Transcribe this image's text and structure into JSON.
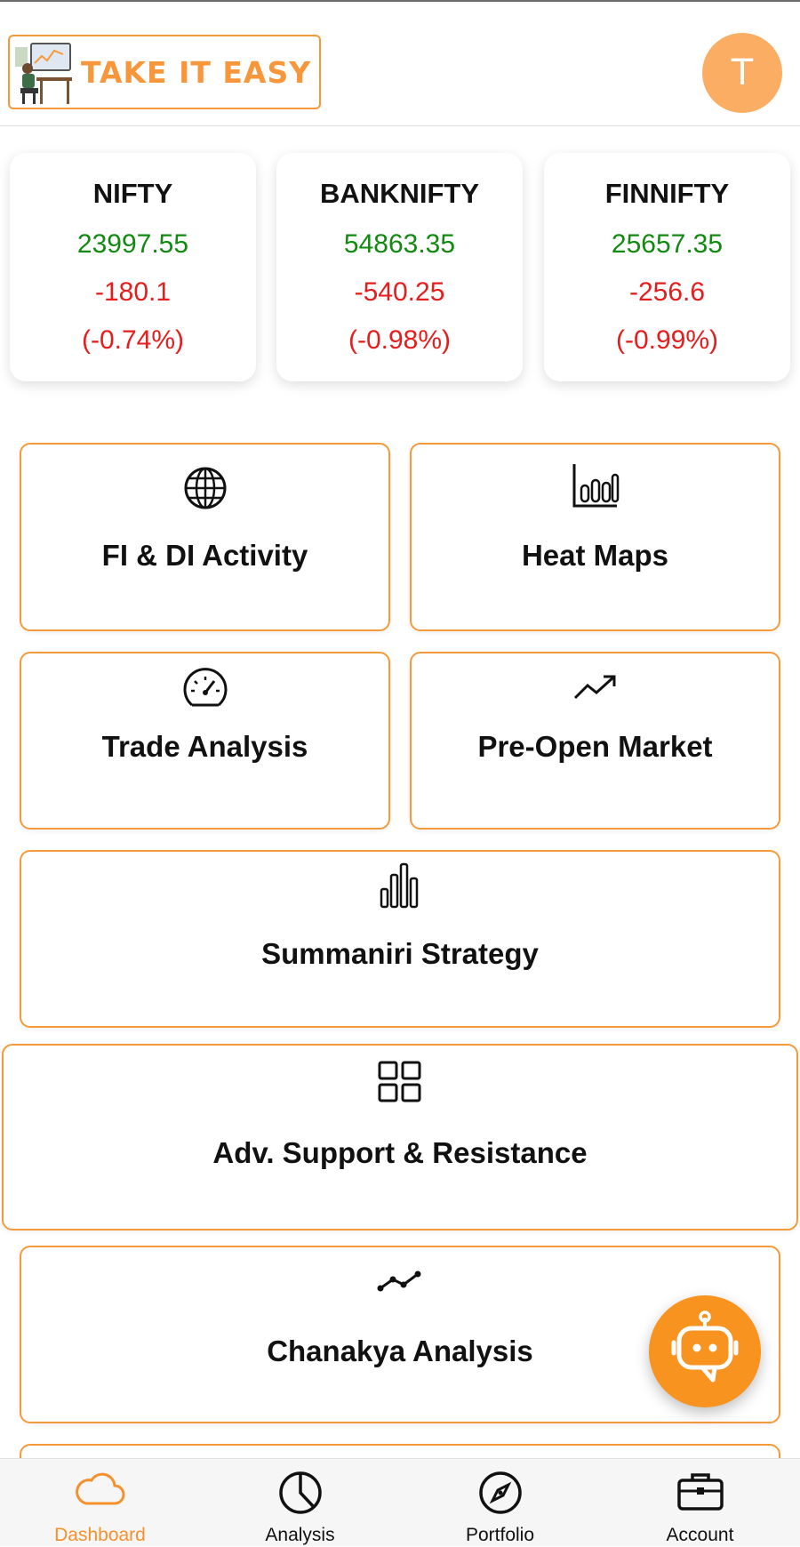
{
  "header": {
    "logo_text": "TAKE IT EASY",
    "avatar_initial": "T"
  },
  "indices": [
    {
      "name": "NIFTY",
      "price": "23997.55",
      "change": "-180.1",
      "percent": "(-0.74%)"
    },
    {
      "name": "BANKNIFTY",
      "price": "54863.35",
      "change": "-540.25",
      "percent": "(-0.98%)"
    },
    {
      "name": "FINNIFTY",
      "price": "25657.35",
      "change": "-256.6",
      "percent": "(-0.99%)"
    }
  ],
  "tiles": [
    {
      "label": "FI & DI Activity",
      "icon": "globe-icon"
    },
    {
      "label": "Heat Maps",
      "icon": "bar-chart-icon"
    },
    {
      "label": "Trade Analysis",
      "icon": "speedometer-icon"
    },
    {
      "label": "Pre-Open Market",
      "icon": "trending-up-icon"
    },
    {
      "label": "Summaniri Strategy",
      "icon": "bars-icon"
    },
    {
      "label": "Adv. Support & Resistance",
      "icon": "grid-icon"
    },
    {
      "label": "Chanakya Analysis",
      "icon": "line-chart-icon"
    }
  ],
  "tabs": [
    {
      "label": "Dashboard",
      "icon": "cloud-icon",
      "active": true
    },
    {
      "label": "Analysis",
      "icon": "pie-chart-icon",
      "active": false
    },
    {
      "label": "Portfolio",
      "icon": "compass-icon",
      "active": false
    },
    {
      "label": "Account",
      "icon": "briefcase-icon",
      "active": false
    }
  ],
  "colors": {
    "accent": "#f59a3a",
    "positive": "#128a12",
    "negative": "#e51d1d",
    "avatar": "#fbad63",
    "fab": "#f7931e"
  }
}
